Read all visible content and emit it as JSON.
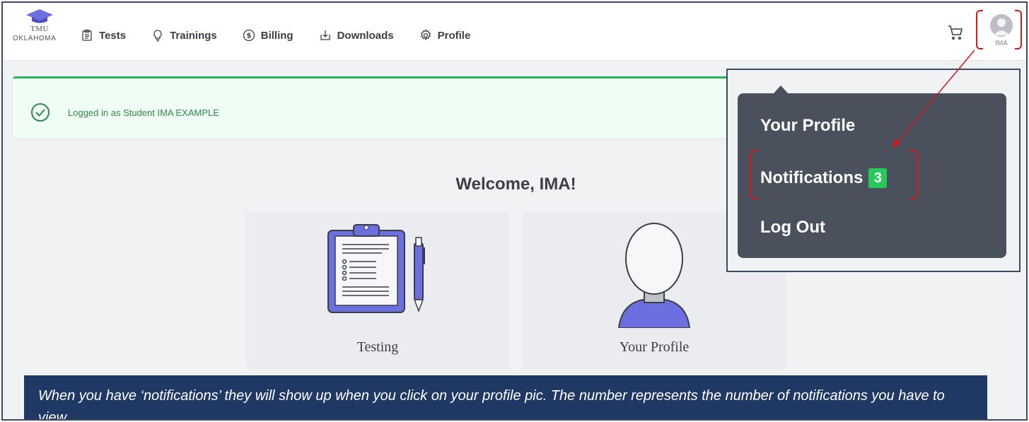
{
  "logo": {
    "name": "TMU",
    "state": "OKLAHOMA"
  },
  "nav": {
    "items": [
      {
        "label": "Tests",
        "icon": "clipboard-icon"
      },
      {
        "label": "Trainings",
        "icon": "lightbulb-icon"
      },
      {
        "label": "Billing",
        "icon": "dollar-circle-icon"
      },
      {
        "label": "Downloads",
        "icon": "download-icon"
      },
      {
        "label": "Profile",
        "icon": "gear-icon"
      }
    ]
  },
  "user": {
    "avatar_label": "IMA"
  },
  "alert": {
    "text": "Logged in as Student IMA EXAMPLE"
  },
  "welcome": "Welcome, IMA!",
  "cards": [
    {
      "label": "Testing",
      "icon": "clipboard-illustration"
    },
    {
      "label": "Your Profile",
      "icon": "person-illustration"
    }
  ],
  "dropdown": {
    "profile": "Your Profile",
    "notifications": "Notifications",
    "notification_count": "3",
    "logout": "Log Out"
  },
  "caption": "When you have ‘notifications’ they will show up when you click on your profile pic.  The number represents the number of notifications you have to view.",
  "colors": {
    "accent": "#6c6fe0",
    "success": "#2ab45a",
    "badge": "#27c95b",
    "dropdown_bg": "#4a505c",
    "caption_bg": "#1f3864",
    "annotation": "#d11a1a"
  }
}
